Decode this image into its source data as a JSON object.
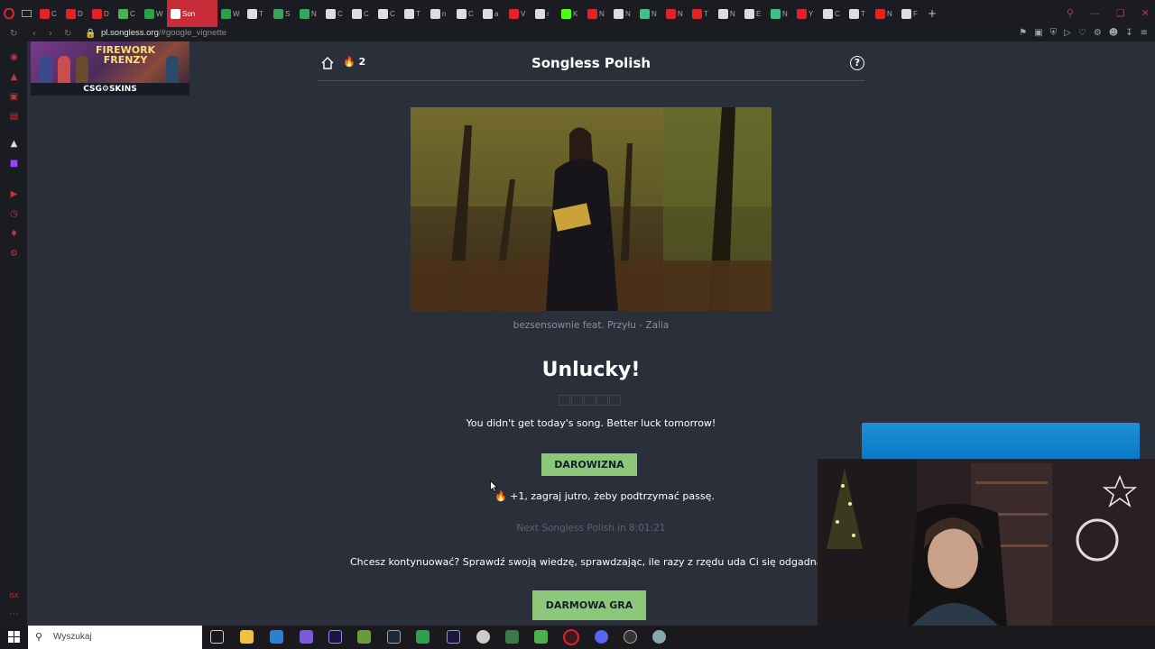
{
  "browser": {
    "active_tab_label": "Son",
    "url_domain": "pl.songless.org",
    "url_path": "/#google_vignette",
    "tabs": [
      {
        "label": "C",
        "color": "#e0232b"
      },
      {
        "label": "D",
        "color": "#e0232b"
      },
      {
        "label": "D",
        "color": "#e0232b"
      },
      {
        "label": "C",
        "color": "#4caf50"
      },
      {
        "label": "W",
        "color": "#2e9f4a"
      },
      {
        "label": "W",
        "color": "#2e9f4a"
      },
      {
        "label": "T",
        "color": "#dddddd"
      },
      {
        "label": "S",
        "color": "#37a35c"
      },
      {
        "label": "N",
        "color": "#37a35c"
      },
      {
        "label": "C",
        "color": "#dddddd"
      },
      {
        "label": "C",
        "color": "#dddddd"
      },
      {
        "label": "C",
        "color": "#dddddd"
      },
      {
        "label": "T",
        "color": "#dddddd"
      },
      {
        "label": "n",
        "color": "#dddddd"
      },
      {
        "label": "C",
        "color": "#dddddd"
      },
      {
        "label": "a",
        "color": "#dddddd"
      },
      {
        "label": "V",
        "color": "#e0232b"
      },
      {
        "label": "r",
        "color": "#dddddd"
      },
      {
        "label": "K",
        "color": "#53fc18"
      },
      {
        "label": "N",
        "color": "#e0232b"
      },
      {
        "label": "N",
        "color": "#dddddd"
      },
      {
        "label": "N",
        "color": "#3fbf8a"
      },
      {
        "label": "N",
        "color": "#e0232b"
      },
      {
        "label": "T",
        "color": "#e0232b"
      },
      {
        "label": "N",
        "color": "#dddddd"
      },
      {
        "label": "E",
        "color": "#dddddd"
      },
      {
        "label": "N",
        "color": "#3fbf8a"
      },
      {
        "label": "Y",
        "color": "#e0232b"
      },
      {
        "label": "C",
        "color": "#dddddd"
      },
      {
        "label": "T",
        "color": "#dddddd"
      },
      {
        "label": "N",
        "color": "#e0232b"
      },
      {
        "label": "F",
        "color": "#dddddd"
      }
    ]
  },
  "ad": {
    "line1": "FIREWORK",
    "line2": "FRENZY",
    "brand": "CSG⚙SKINS"
  },
  "header": {
    "streak_count": "2",
    "title": "Songless Polish",
    "help_symbol": "?"
  },
  "song": {
    "name": "bezsensownie feat. Przyłu - Zalia"
  },
  "result": {
    "heading": "Unlucky!",
    "message": "You didn't get today's song. Better luck tomorrow!",
    "donate_button": "DAROWIZNA",
    "streak_message": "+1, zagraj jutro, żeby podtrzymać passę.",
    "next_text": "Next Songless Polish in 8:01:21",
    "continue_text": "Chcesz kontynuować? Sprawdź swoją wiedzę, sprawdzając, ile razy z rzędu uda Ci się odgadnąć poprawn",
    "free_game_button": "DARMOWA GRA"
  },
  "taskbar": {
    "search_placeholder": "Wyszukaj"
  }
}
